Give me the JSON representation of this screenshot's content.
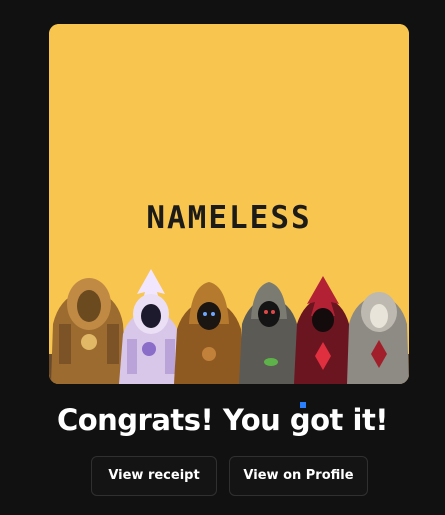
{
  "nft": {
    "title": "NAMELESS",
    "background_color": "#f8c54f"
  },
  "headline": "Congrats! You got it!",
  "actions": {
    "view_receipt": "View receipt",
    "view_profile": "View on Profile"
  },
  "colors": {
    "page_background": "#111111",
    "button_background": "#141414",
    "button_border": "#303030",
    "text": "#ffffff"
  }
}
